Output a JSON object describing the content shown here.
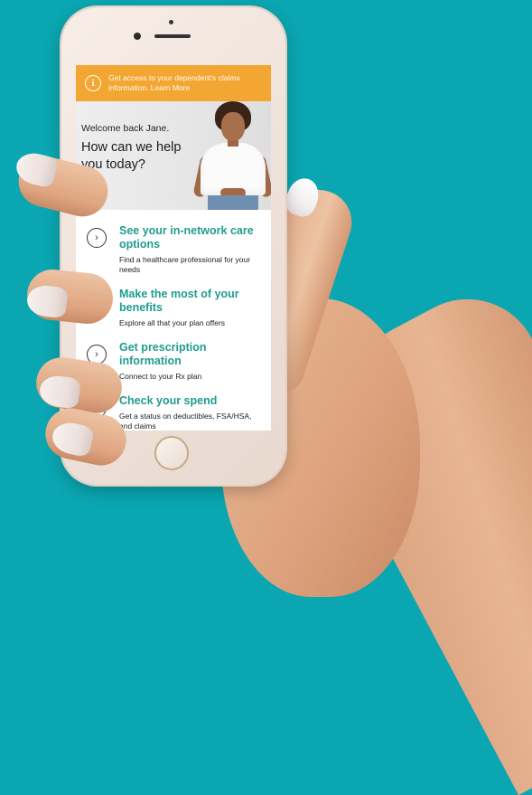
{
  "banner": {
    "text": "Get access to your dependent's claims information. Learn More",
    "color": "#f3a732",
    "icon": "info-icon"
  },
  "hero": {
    "welcome": "Welcome back Jane.",
    "headline": "How can we help you today?"
  },
  "list": {
    "items": [
      {
        "title": "See your in-network care options",
        "subtitle": "Find a healthcare professional for your needs",
        "icon": "chevron-right-icon"
      },
      {
        "title": "Make the most of your benefits",
        "subtitle": "Explore all that your plan offers",
        "icon": "chevron-right-icon"
      },
      {
        "title": "Get prescription information",
        "subtitle": "Connect to your Rx plan",
        "icon": "chevron-right-icon"
      },
      {
        "title": "Check your spend",
        "subtitle": "Get a status on deductibles, FSA/HSA, and claims",
        "icon": "chevron-right-icon"
      }
    ],
    "accent": "#1f9d8f"
  },
  "background_color": "#0aa6b1"
}
